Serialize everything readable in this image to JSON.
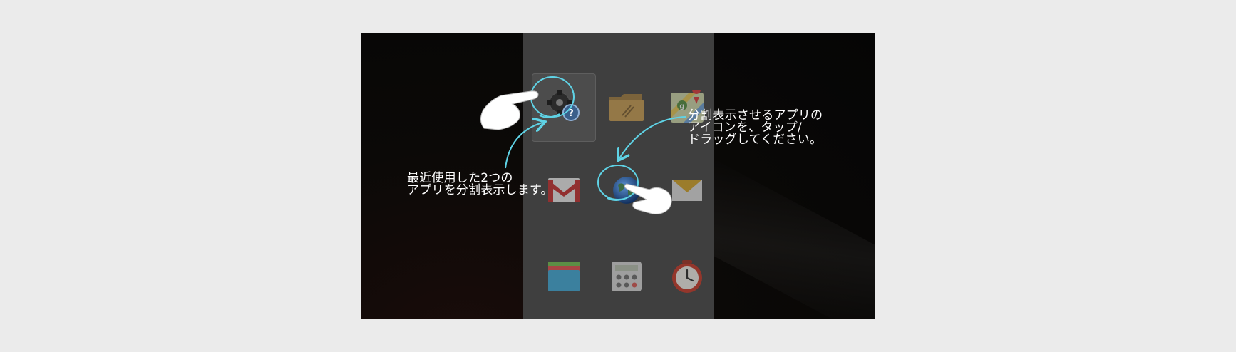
{
  "tutorial": {
    "hint_right": [
      "分割表示させるアプリの",
      "アイコンを、タップ/",
      "ドラッグしてください。"
    ],
    "hint_left": [
      "最近使用した2つの",
      "アプリを分割表示します。"
    ]
  },
  "apps": [
    {
      "name": "settings-help",
      "icon": "settings-help-icon"
    },
    {
      "name": "file-manager",
      "icon": "folder-icon"
    },
    {
      "name": "maps",
      "icon": "maps-icon"
    },
    {
      "name": "gmail",
      "icon": "gmail-icon"
    },
    {
      "name": "browser",
      "icon": "globe-icon"
    },
    {
      "name": "email",
      "icon": "envelope-icon"
    },
    {
      "name": "gallery",
      "icon": "gallery-icon"
    },
    {
      "name": "calculator",
      "icon": "calculator-icon"
    },
    {
      "name": "clock",
      "icon": "alarm-clock-icon"
    }
  ],
  "colors": {
    "highlight": "#5fd3e6",
    "panel": "#3f3f3f",
    "background": "#ebebeb"
  }
}
